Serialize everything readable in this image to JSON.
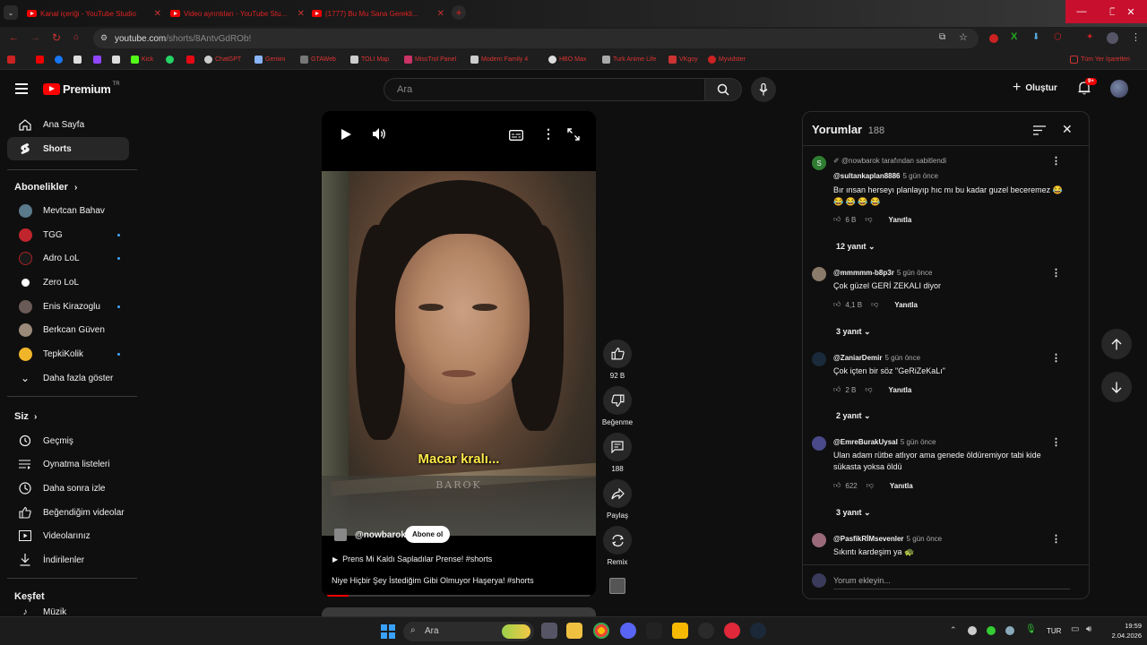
{
  "browser": {
    "tabs": [
      {
        "title": "Kanal içeriği - YouTube Studio"
      },
      {
        "title": "Video ayrıntıları - YouTube Stu..."
      },
      {
        "title": "(1777) Bu Mu Sana Gerekli..."
      }
    ],
    "url_host": "youtube.com",
    "url_path": "/shorts/8AntvGdROb!",
    "bookmarks": [
      "Kick",
      "ChatGPT",
      "Gemini",
      "GTAWeb",
      "TOLI Map",
      "MissTrol Panel",
      "Modern Family 4",
      "HBO Max",
      "Turk Anime Life",
      "VKgoy",
      "Myvidster"
    ],
    "all_bookmarks": "Tüm Yer İşaretleri"
  },
  "yt": {
    "logo": "Premium",
    "logo_sup": "TR",
    "search_placeholder": "Ara",
    "create_label": "Oluştur",
    "notif_badge": "9+"
  },
  "sidebar": {
    "home": "Ana Sayfa",
    "shorts": "Shorts",
    "subs_header": "Abonelikler",
    "subs": [
      {
        "name": "Mevtcan Bahav",
        "color": "#5a7a8c",
        "dot": false
      },
      {
        "name": "TGG",
        "color": "#c0242c",
        "dot": true
      },
      {
        "name": "Adro LoL",
        "color": "#1a1a1a",
        "dot": true
      },
      {
        "name": "Zero LoL",
        "color": "#ffffff",
        "dot": false
      },
      {
        "name": "Enis Kirazoglu",
        "color": "#6a5a55",
        "dot": true
      },
      {
        "name": "Berkcan Güven",
        "color": "#9a8a7a",
        "dot": false
      },
      {
        "name": "TepkiKolik",
        "color": "#f0b62a",
        "dot": true
      }
    ],
    "show_more": "Daha fazla göster",
    "you_header": "Siz",
    "you_items": [
      "Geçmiş",
      "Oynatma listeleri",
      "Daha sonra izle",
      "Beğendiğim videolar",
      "Videolarınız",
      "İndirilenler"
    ],
    "explore_header": "Keşfet",
    "music": "Müzik"
  },
  "short": {
    "caption": "Macar kralı...",
    "watermark": "BAROK",
    "channel": "@nowbarok",
    "subscribe": "Abone ol",
    "playlist_title": "Prens Mi Kaldı Sapladılar Prense! #shorts",
    "description": "Niye Hiçbir Şey İstediğim Gibi Olmuyor Haşerya! #shorts",
    "progress": 0.08,
    "likes": "92 B",
    "dislike_label": "Beğenme",
    "comments_count": "188",
    "share_label": "Paylaş",
    "remix_label": "Remix"
  },
  "comments": {
    "title": "Yorumlar",
    "count": "188",
    "pinned": "@nowbarok tarafından sabitlendi",
    "reply_label": "Yanıtla",
    "add_placeholder": "Yorum ekleyin...",
    "items": [
      {
        "handle": "@sultankaplan8886",
        "time": "5 gün önce",
        "text": "Bır ınsan herseyı planlayıp hıc mı bu kadar guzel beceremez 😂 😂 😂 😂 😂",
        "likes": "6 B",
        "replies": "12 yanıt",
        "avatar": "#2e7d32",
        "initial": "S"
      },
      {
        "handle": "@mmmmm-b8p3r",
        "time": "5 gün önce",
        "text": "Çok güzel GERİ ZEKALI diyor",
        "likes": "4,1 B",
        "replies": "3 yanıt",
        "avatar": "#8a7a6a",
        "initial": ""
      },
      {
        "handle": "@ZaniarDemir",
        "time": "5 gün önce",
        "text": "Çok içten bir söz \"GeRiZeKaLı\"",
        "likes": "2 B",
        "replies": "2 yanıt",
        "avatar": "#1a2a3a",
        "initial": ""
      },
      {
        "handle": "@EmreBurakUysal",
        "time": "5 gün önce",
        "text": "Ulan adam rütbe atlıyor ama genede öldüremiyor tabi kide sükasta yoksa öldü",
        "likes": "622",
        "replies": "3 yanıt",
        "avatar": "#4a4a8a",
        "initial": ""
      },
      {
        "handle": "@PasfikRİMsevenler",
        "time": "5 gün önce",
        "text": "Sıkıntı kardeşim ya 🐢",
        "likes": "",
        "replies": "",
        "avatar": "#9a6a7a",
        "initial": ""
      }
    ]
  },
  "taskbar": {
    "search": "Ara",
    "lang": "TUR",
    "time": "19:59",
    "date": "2.04.2026"
  }
}
